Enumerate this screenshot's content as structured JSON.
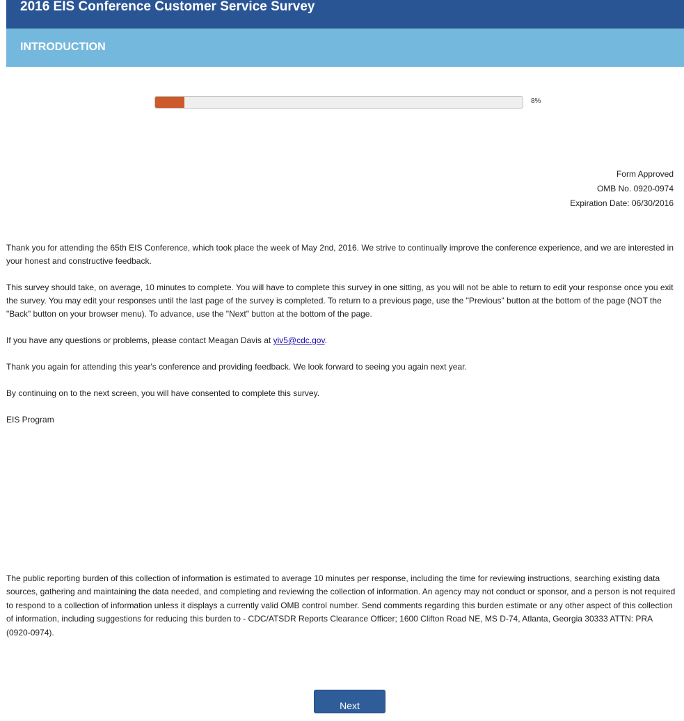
{
  "header": {
    "title": "2016 EIS Conference Customer Service Survey"
  },
  "section": {
    "label": "INTRODUCTION"
  },
  "progress": {
    "percent": 8,
    "label": "8%"
  },
  "approval": {
    "line1": "Form Approved",
    "line2": "OMB No. 0920-0974",
    "line3": "Expiration Date: 06/30/2016"
  },
  "intro": {
    "p1": "Thank you for attending the 65th EIS Conference, which took place the week of May 2nd, 2016. We strive to continually improve the conference experience, and we are interested in your honest and constructive feedback.",
    "p2": "This survey should take, on average, 10 minutes to complete. You will have to complete this survey in one sitting, as you will not be able to return to edit your response once you exit the survey. You may edit your responses until the last page of the survey is completed. To return to a previous page, use the \"Previous\" button at the bottom of the page (NOT the \"Back\" button on your browser menu). To advance, use the \"Next\" button at the bottom of the page.",
    "p3_before": "If you have any questions or problems, please contact Meagan Davis at ",
    "p3_email": "yiv5@cdc.gov",
    "p3_after": ".",
    "p4": "Thank you again for attending this year's conference and providing feedback. We look forward to seeing you again next year.",
    "p5": "By continuing on to the next screen, you will have consented to complete this survey.",
    "p6": "EIS Program"
  },
  "burden": {
    "text": "The public reporting burden of this collection of information is estimated to average 10 minutes per response, including the time for reviewing instructions, searching existing data sources, gathering and maintaining the data needed, and completing and reviewing the collection of information. An agency may not conduct or sponsor, and a person is not required to respond to a collection of information unless it displays a currently valid OMB control number. Send comments regarding this burden estimate or any other aspect of this collection of information, including suggestions for reducing this burden to - CDC/ATSDR Reports Clearance Officer; 1600 Clifton Road NE, MS D-74, Atlanta, Georgia 30333 ATTN: PRA (0920-0974)."
  },
  "buttons": {
    "next_label": "Next"
  },
  "colors": {
    "header_bg": "#2a5595",
    "section_bg": "#75b8de",
    "progress_fill": "#cc5a2a",
    "button_bg": "#2f5d99"
  }
}
